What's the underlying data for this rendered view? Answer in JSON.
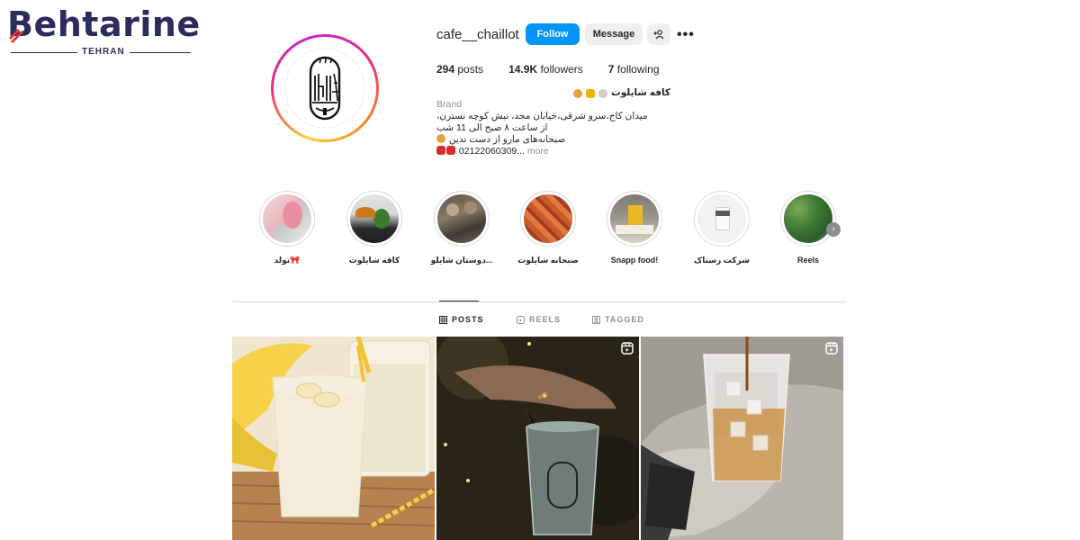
{
  "watermark": {
    "brand": "Behtarine",
    "city": "TEHRAN"
  },
  "profile": {
    "username": "cafe__chaillot",
    "follow_label": "Follow",
    "message_label": "Message",
    "more_label": "•••",
    "stats": {
      "posts": "294",
      "posts_label": "posts",
      "followers": "14.9K",
      "followers_label": "followers",
      "following": "7",
      "following_label": "following"
    },
    "bio": {
      "name": "کافه شایلوت",
      "category": "Brand",
      "line1": "میدان کاج،سرو شرقی،خیابان مجد، نبش کوچه نسترن،",
      "line2": "از ساعت ۸ صبح الی 11 شب",
      "line3": "صبحانه‌های مارو از دست ندین",
      "line4": "02122060309...",
      "more": "more"
    }
  },
  "highlights": [
    {
      "label": "تولد🎀"
    },
    {
      "label": "کافه شایلوت"
    },
    {
      "label": "دوستان شایلو..."
    },
    {
      "label": "صبحانه شایلوت"
    },
    {
      "label": "Snapp food!"
    },
    {
      "label": "شرکت رستاک"
    },
    {
      "label": "Reels"
    }
  ],
  "tabs": {
    "posts": "POSTS",
    "reels": "REELS",
    "tagged": "TAGGED"
  },
  "colors": {
    "follow": "#0095f6",
    "secondary_button": "#efefef",
    "text": "#262626",
    "muted": "#8e8e8e",
    "divider": "#dbdbdb",
    "brand": "#2a2d5c"
  }
}
